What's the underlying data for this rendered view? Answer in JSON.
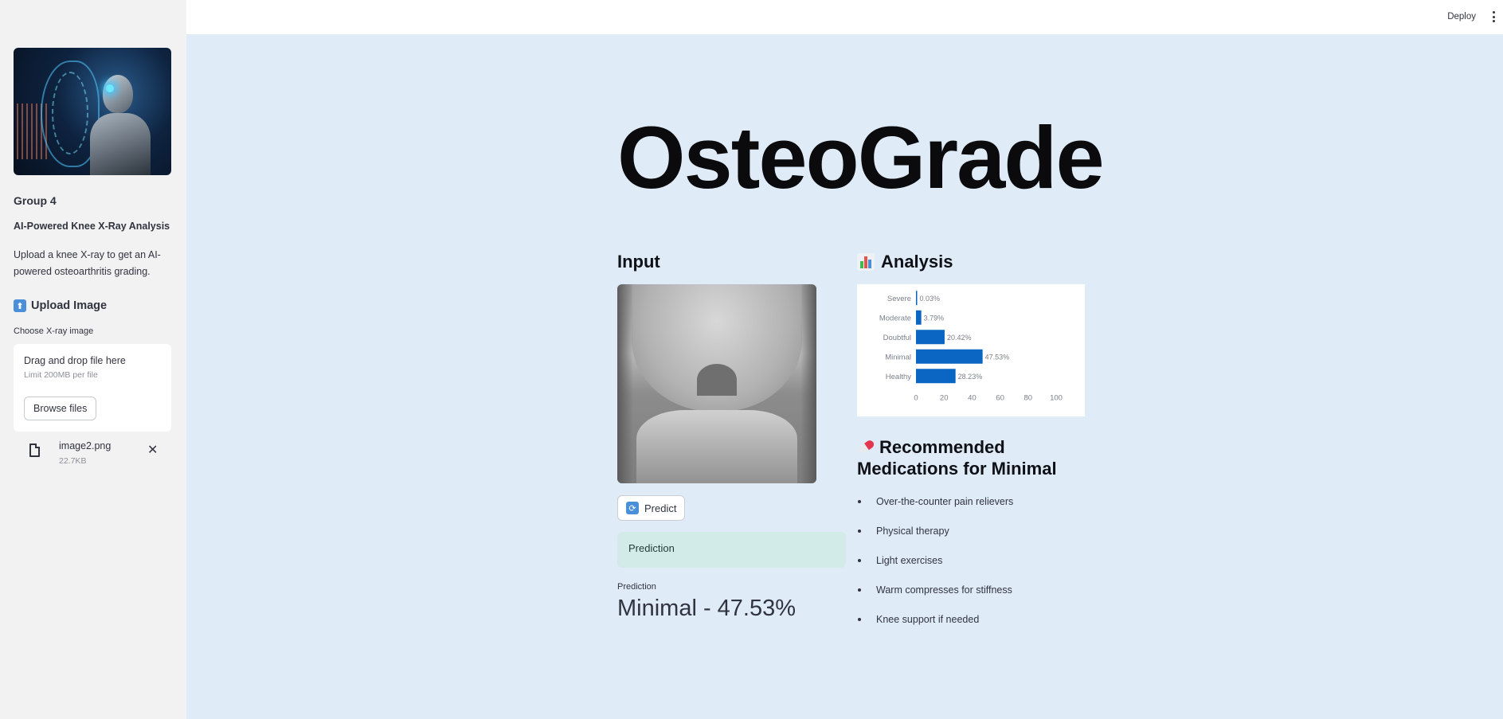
{
  "topbar": {
    "deploy_label": "Deploy",
    "menu_icon": "more-vert-icon"
  },
  "sidebar": {
    "group_title": "Group 4",
    "app_subtitle": "AI-Powered Knee X-Ray Analysis",
    "description": "Upload a knee X-ray to get an AI-powered osteoarthritis grading.",
    "upload_heading": "Upload Image",
    "upload_icon": "up-arrow-icon",
    "uploader": {
      "label": "Choose X-ray image",
      "drag_text": "Drag and drop file here",
      "limit_text": "Limit 200MB per file",
      "browse_label": "Browse files"
    },
    "file": {
      "name": "image2.png",
      "size": "22.7KB"
    }
  },
  "main": {
    "title": "OsteoGrade",
    "input_heading": "Input",
    "analysis_heading": "Analysis",
    "analysis_icon": "bar-chart-icon",
    "predict_button": "Predict",
    "predict_icon": "refresh-icon",
    "prediction_box": "Prediction",
    "metric_label": "Prediction",
    "metric_value": "Minimal - 47.53%",
    "medications_heading": "Recommended Medications for Minimal",
    "medications_icon": "pill-icon",
    "medications": [
      "Over-the-counter pain relievers",
      "Physical therapy",
      "Light exercises",
      "Warm compresses for stiffness",
      "Knee support if needed"
    ]
  },
  "colors": {
    "bar": "#0a66c2",
    "prediction_bg": "#d3ebe8",
    "page_bg": "#dfecf8"
  },
  "chart_data": {
    "type": "bar",
    "orientation": "horizontal",
    "categories": [
      "Severe",
      "Moderate",
      "Doubtful",
      "Minimal",
      "Healthy"
    ],
    "values": [
      0.03,
      3.79,
      20.42,
      47.53,
      28.23
    ],
    "value_labels": [
      "0.03%",
      "3.79%",
      "20.42%",
      "47.53%",
      "28.23%"
    ],
    "xlim": [
      0,
      100
    ],
    "xticks": [
      0,
      20,
      40,
      60,
      80,
      100
    ],
    "grid": false
  }
}
